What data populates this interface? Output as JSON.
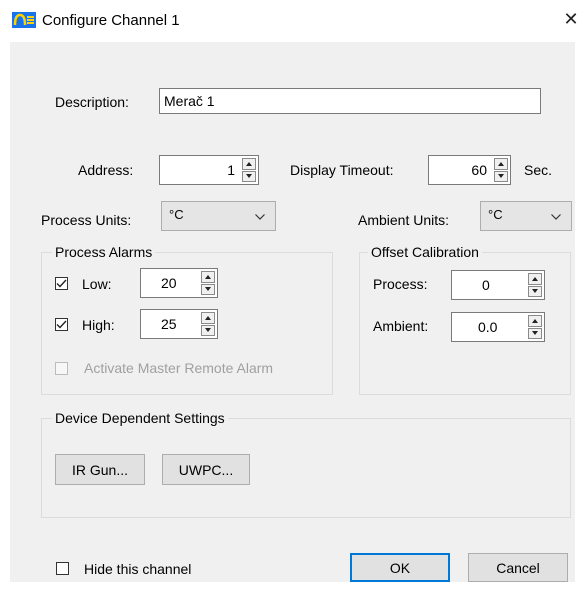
{
  "window": {
    "title": "Configure Channel 1",
    "close_glyph": "✕",
    "icon": "app-logo-icon",
    "accent": "#0078d7"
  },
  "description": {
    "label": "Description:",
    "value": "Merač 1"
  },
  "address": {
    "label": "Address:",
    "value": "1"
  },
  "display_timeout": {
    "label": "Display Timeout:",
    "value": "60",
    "unit": "Sec."
  },
  "process_units": {
    "label": "Process Units:",
    "selected": "°C"
  },
  "ambient_units": {
    "label": "Ambient Units:",
    "selected": "°C"
  },
  "process_alarms": {
    "title": "Process Alarms",
    "low": {
      "label": "Low:",
      "checked": true,
      "value": "20"
    },
    "high": {
      "label": "High:",
      "checked": true,
      "value": "25"
    },
    "master_remote": {
      "label": "Activate Master Remote Alarm",
      "checked": false,
      "enabled": false
    }
  },
  "offset_calibration": {
    "title": "Offset Calibration",
    "process": {
      "label": "Process:",
      "value": "0"
    },
    "ambient": {
      "label": "Ambient:",
      "value": "0.0"
    }
  },
  "device_settings": {
    "title": "Device Dependent Settings",
    "ir_gun_label": "IR Gun...",
    "uwpc_label": "UWPC..."
  },
  "hide_channel": {
    "label": "Hide this channel",
    "checked": false
  },
  "buttons": {
    "ok": "OK",
    "cancel": "Cancel"
  }
}
